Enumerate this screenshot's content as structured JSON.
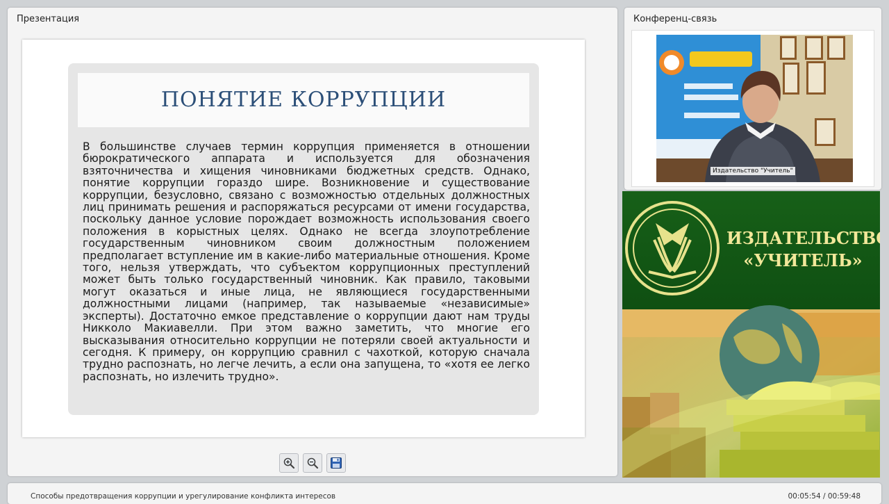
{
  "presentation": {
    "panel_title": "Презентация",
    "slide_title": "ПОНЯТИЕ КОРРУПЦИИ",
    "slide_body": "В большинстве случаев термин коррупция применяется в отношении бюрократического аппарата и используется для обозначения взяточничества и хищения чиновниками бюджетных средств. Однако, понятие коррупции гораздо шире. Возникновение и существование коррупции, безусловно, связано с возможностью отдельных должностных лиц принимать решения и распоряжаться ресурсами от имени государства, поскольку данное условие порождает возможность использования своего положения в корыстных целях. Однако не всегда злоупотребление государственным чиновником своим должностным положением предполагает вступление им в какие-либо материальные отношения. Кроме того, нельзя утверждать, что субъектом коррупционных преступлений может быть только государственный чиновник. Как правило, таковыми могут оказаться и иные лица, не являющиеся государственными должностными лицами (например, так называемые «независимые» эксперты). Достаточно емкое представление о коррупции дают нам труды Никколо Макиавелли. При этом важно заметить, что многие его высказывания относительно коррупции не потеряли своей актуальности и сегодня. К примеру, он коррупцию сравнил с чахоткой, которую сначала трудно распознать, но легче лечить, а если она запущена, то «хотя ее легко распознать, но излечить трудно».",
    "toolbar": {
      "zoom_in_icon": "zoom-in-icon",
      "zoom_out_icon": "zoom-out-icon",
      "save_icon": "floppy-disk-icon"
    }
  },
  "conference": {
    "panel_title": "Конференц-связь",
    "video_label": "Издательство \"Учитель\""
  },
  "brand": {
    "line1": "ИЗДАТЕЛЬСТВО",
    "line2": "«УЧИТЕЛЬ»"
  },
  "footer": {
    "course_title": "Способы предотвращения коррупции и урегулирование конфликта интересов",
    "time": "00:05:54 / 00:59:48"
  },
  "colors": {
    "slide_title": "#2c4f78",
    "brand_green": "#1d6a1f",
    "brand_text": "#f2e89a"
  }
}
